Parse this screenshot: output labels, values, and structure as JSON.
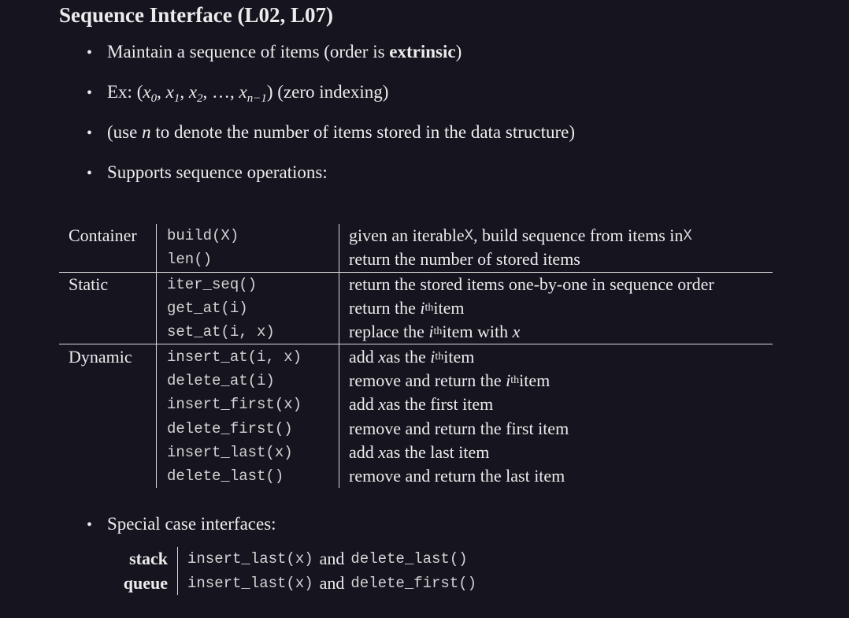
{
  "title": "Sequence Interface (L02, L07)",
  "bullets": {
    "b1": {
      "pre": "Maintain a sequence of items (order is ",
      "bold": "extrinsic",
      "post": ")"
    },
    "b2": {
      "pre": "Ex: ",
      "math_open": "(",
      "x": "x",
      "s0": "0",
      "s1": "1",
      "s2": "2",
      "dots": "…",
      "sn": "n−1",
      "math_close": ")",
      "post": " (zero indexing)"
    },
    "b3": {
      "pre": "(use ",
      "n": "n",
      "post": " to denote the number of items stored in the data structure)"
    },
    "b4": {
      "text": "Supports sequence operations:"
    },
    "dot": "•"
  },
  "ops": {
    "container": {
      "label": "Container",
      "rows": [
        {
          "fn": "build(X)",
          "d_pre": "given an iterable ",
          "d_code": "X",
          "d_mid": ", build sequence from items in ",
          "d_code2": "X"
        },
        {
          "fn": "len()",
          "d_text": "return the number of stored items"
        }
      ]
    },
    "static": {
      "label": "Static",
      "rows": [
        {
          "fn": "iter_seq()",
          "d_text": "return the stored items one-by-one in sequence order"
        },
        {
          "fn": "get_at(i)",
          "d_pre": "return the ",
          "i": "i",
          "th": "th",
          "d_post": " item"
        },
        {
          "fn": "set_at(i, x)",
          "d_pre": "replace the ",
          "i": "i",
          "th": "th",
          "d_mid": " item with ",
          "x": "x"
        }
      ]
    },
    "dynamic": {
      "label": "Dynamic",
      "rows": [
        {
          "fn": "insert_at(i, x)",
          "d_pre": "add ",
          "x": "x",
          "d_mid": " as the ",
          "i": "i",
          "th": "th",
          "d_post": " item"
        },
        {
          "fn": "delete_at(i)",
          "d_pre": "remove and return the ",
          "i": "i",
          "th": "th",
          "d_post": " item"
        },
        {
          "fn": "insert_first(x)",
          "d_pre": "add ",
          "x": "x",
          "d_post": " as the first item"
        },
        {
          "fn": "delete_first()",
          "d_text": "remove and return the first item"
        },
        {
          "fn": "insert_last(x)",
          "d_pre": "add ",
          "x": "x",
          "d_post": " as the last item"
        },
        {
          "fn": "delete_last()",
          "d_text": "remove and return the last item"
        }
      ]
    }
  },
  "special": {
    "heading": "Special case interfaces:",
    "stack": {
      "name": "stack",
      "op1": "insert_last(x)",
      "and": "and",
      "op2": "delete_last()"
    },
    "queue": {
      "name": "queue",
      "op1": "insert_last(x)",
      "and": "and",
      "op2": "delete_first()"
    }
  }
}
